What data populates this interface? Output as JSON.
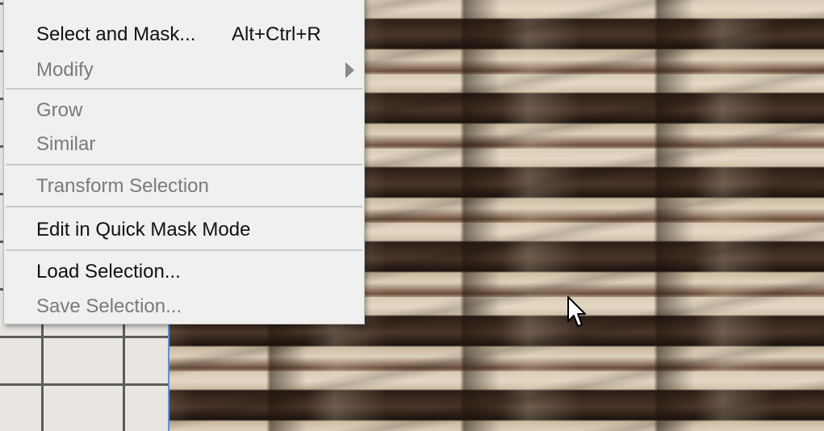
{
  "menu": {
    "items": [
      {
        "label": "Select and Mask...",
        "shortcut": "Alt+Ctrl+R",
        "enabled": true
      },
      {
        "label": "Modify",
        "enabled": false,
        "has_submenu": true
      },
      {
        "label": "Grow",
        "enabled": false
      },
      {
        "label": "Similar",
        "enabled": false
      },
      {
        "label": "Transform Selection",
        "enabled": false
      },
      {
        "label": "Edit in Quick Mask Mode",
        "enabled": true
      },
      {
        "label": "Load Selection...",
        "enabled": true
      },
      {
        "label": "Save Selection...",
        "enabled": false
      }
    ]
  },
  "icons": {
    "submenu": "chevron-right-icon",
    "cursor": "mouse-pointer-icon"
  },
  "colors": {
    "menu_bg": "#f0f0f0",
    "disabled_text": "#7a7a7a",
    "enabled_text": "#111111",
    "guide": "#5b8fe3"
  }
}
